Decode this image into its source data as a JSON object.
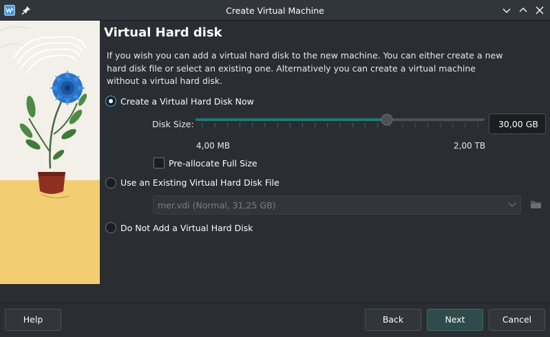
{
  "window": {
    "title": "Create Virtual Machine"
  },
  "page": {
    "title": "Virtual Hard disk",
    "description_lines": [
      "If you wish you can add a virtual hard disk to the new machine. You can either create a new",
      "hard disk file or select an existing one. Alternatively you can create a virtual machine",
      "without a virtual hard disk."
    ]
  },
  "options": {
    "create_new": {
      "label": "Create a Virtual Hard Disk Now",
      "checked": true
    },
    "use_existing": {
      "label": "Use an Existing Virtual Hard Disk File",
      "checked": false
    },
    "no_disk": {
      "label": "Do Not Add a Virtual Hard Disk",
      "checked": false
    }
  },
  "disk_size": {
    "label": "Disk Size:",
    "value": "30,00 GB",
    "min_label": "4,00 MB",
    "max_label": "2,00 TB",
    "slider_fraction": 0.67
  },
  "preallocate": {
    "label": "Pre-allocate Full Size",
    "checked": false
  },
  "existing_file": {
    "selected": "mer.vdi (Normal, 31,25 GB)"
  },
  "buttons": {
    "help": "Help",
    "back": "Back",
    "next": "Next",
    "cancel": "Cancel"
  },
  "colors": {
    "accent": "#3daee9",
    "slider_fill": "#1d7a72",
    "background": "#2a2e32"
  }
}
